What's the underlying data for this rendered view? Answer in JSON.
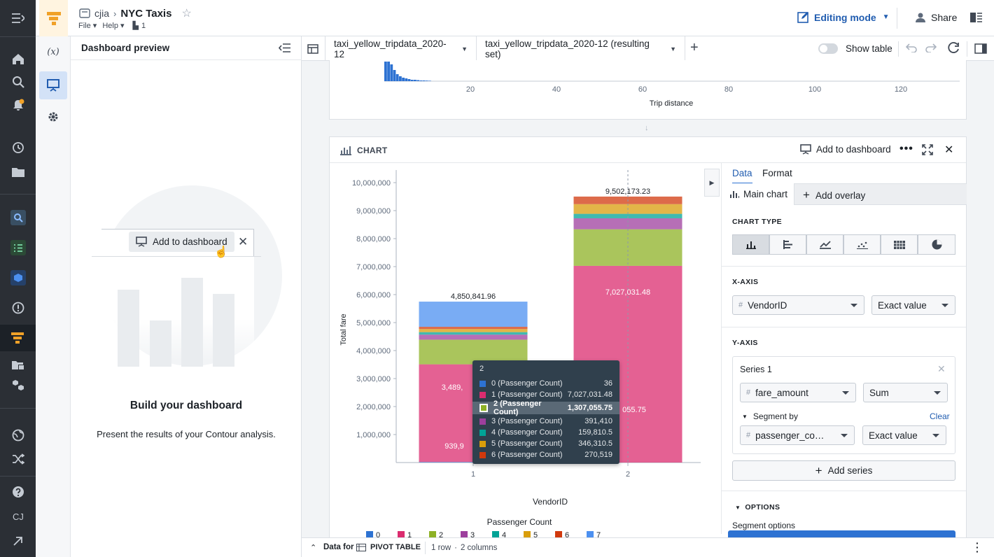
{
  "header": {
    "breadcrumb_parent": "cjia",
    "title": "NYC Taxis",
    "menu_file": "File",
    "menu_help": "Help",
    "collab_count": "1",
    "editing_mode": "Editing mode",
    "share": "Share"
  },
  "rail": {
    "user_initials": "CJ"
  },
  "tools": {
    "variables": "(x)"
  },
  "dashboard": {
    "heading": "Dashboard preview",
    "add_button": "Add to dashboard",
    "build_title": "Build your dashboard",
    "build_subtitle": "Present the results of your Contour analysis."
  },
  "tabs": [
    {
      "label": "taxi_yellow_tripdata_2020-12"
    },
    {
      "label": "taxi_yellow_tripdata_2020-12 (resulting set)"
    }
  ],
  "show_table": "Show table",
  "histogram": {
    "xlabel": "Trip distance",
    "ticks": [
      "20",
      "40",
      "60",
      "80",
      "100",
      "120"
    ]
  },
  "chart_card": {
    "title": "CHART",
    "add_to_dashboard": "Add to dashboard"
  },
  "chart_data": {
    "type": "bar",
    "stacked": true,
    "categories": [
      "1",
      "2"
    ],
    "xlabel": "VendorID",
    "ylabel": "Total fare",
    "ylim": [
      0,
      10000000
    ],
    "yticks": [
      "1,000,000",
      "2,000,000",
      "3,000,000",
      "4,000,000",
      "5,000,000",
      "6,000,000",
      "7,000,000",
      "8,000,000",
      "9,000,000",
      "10,000,000"
    ],
    "totals": [
      "4,850,841.96",
      "9,502,173.23"
    ],
    "segment_labels": [
      {
        "category": "1",
        "text": "3,489,"
      },
      {
        "category": "1",
        "text": "939,9"
      },
      {
        "category": "2",
        "text": "7,027,031.48"
      },
      {
        "category": "2",
        "text": "055.75"
      }
    ],
    "legend_title": "Passenger Count",
    "series": [
      {
        "name": "0",
        "color": "#2d72d2",
        "values": [
          20000,
          36
        ]
      },
      {
        "name": "1",
        "color": "#db2c6f",
        "values": [
          3489000,
          7027031.48
        ]
      },
      {
        "name": "2",
        "color": "#8eb125",
        "values": [
          880000,
          1307055.75
        ]
      },
      {
        "name": "3",
        "color": "#9d3f9d",
        "values": [
          180000,
          391410
        ]
      },
      {
        "name": "4",
        "color": "#00a396",
        "values": [
          90000,
          159810.5
        ]
      },
      {
        "name": "5",
        "color": "#d99e0b",
        "values": [
          110000,
          346310.5
        ]
      },
      {
        "name": "6",
        "color": "#d1390d",
        "values": [
          80000,
          270519
        ]
      },
      {
        "name": "7",
        "color": "#4c90f0",
        "values": [
          900000,
          0
        ]
      }
    ]
  },
  "tooltip": {
    "title": "2",
    "rows": [
      {
        "label": "0 (Passenger Count)",
        "value": "36",
        "color": "#2d72d2"
      },
      {
        "label": "1 (Passenger Count)",
        "value": "7,027,031.48",
        "color": "#db2c6f"
      },
      {
        "label": "2 (Passenger Count)",
        "value": "1,307,055.75",
        "color": "#8eb125"
      },
      {
        "label": "3 (Passenger Count)",
        "value": "391,410",
        "color": "#9d3f9d"
      },
      {
        "label": "4 (Passenger Count)",
        "value": "159,810.5",
        "color": "#00a396"
      },
      {
        "label": "5 (Passenger Count)",
        "value": "346,310.5",
        "color": "#d99e0b"
      },
      {
        "label": "6 (Passenger Count)",
        "value": "270,519",
        "color": "#d1390d"
      }
    ]
  },
  "config": {
    "tab_data": "Data",
    "tab_format": "Format",
    "main_chart": "Main chart",
    "add_overlay": "Add overlay",
    "chart_type_label": "CHART TYPE",
    "xaxis_label": "X-AXIS",
    "x_field": "VendorID",
    "x_mode": "Exact value",
    "yaxis_label": "Y-AXIS",
    "series_name": "Series 1",
    "y_field": "fare_amount",
    "y_agg": "Sum",
    "segment_by": "Segment by",
    "clear": "Clear",
    "seg_field": "passenger_co…",
    "seg_mode": "Exact value",
    "add_series": "Add series",
    "options_label": "OPTIONS",
    "segment_options": "Segment options"
  },
  "footer": {
    "data_for": "Data for",
    "pivot": "PIVOT TABLE",
    "rows": "1 row",
    "dot": "·",
    "cols": "2 columns"
  },
  "colors": {
    "accent": "#2d72d2",
    "rail": "#2b2f35",
    "pink": "#db2c6f",
    "green": "#8eb125"
  }
}
